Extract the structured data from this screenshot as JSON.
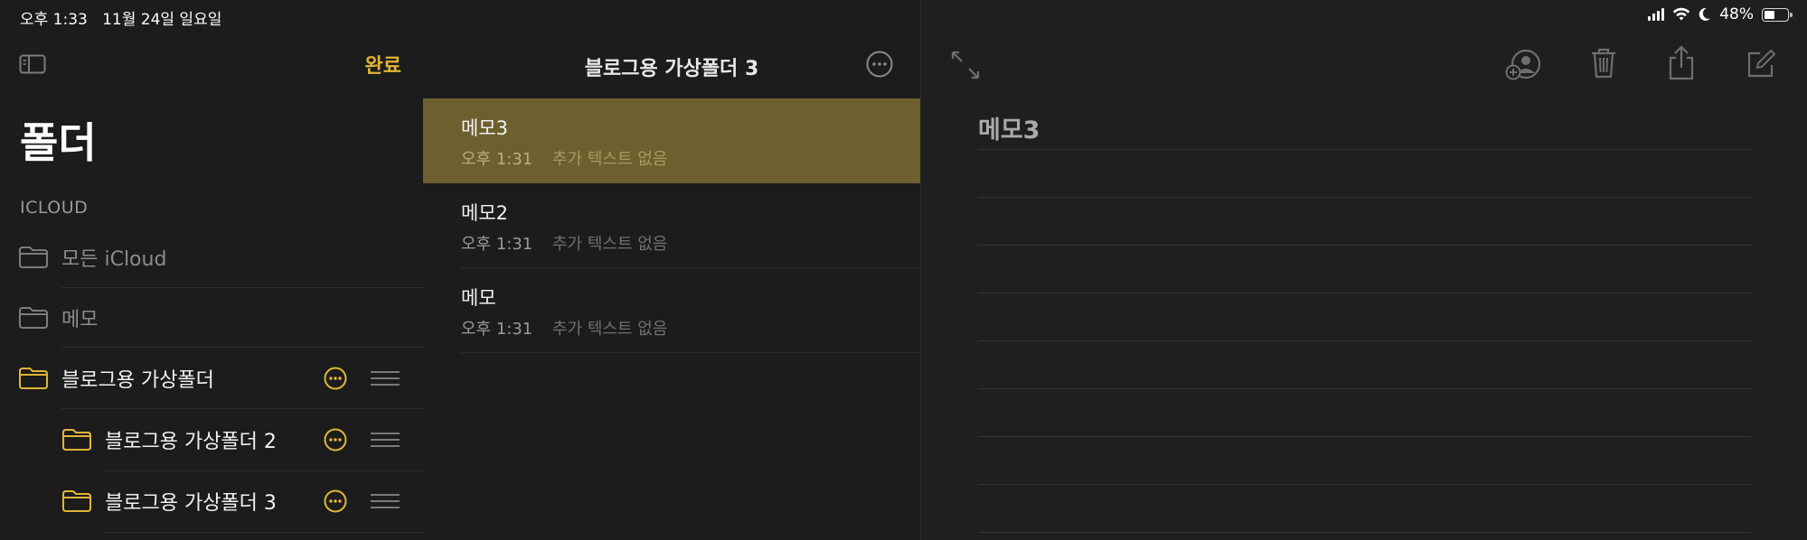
{
  "status": {
    "time": "오후 1:33",
    "date": "11월 24일 일요일",
    "battery": "48%",
    "battery_level": 0.48
  },
  "sidebar": {
    "done_label": "완료",
    "title": "폴더",
    "section": "ICLOUD",
    "folders": [
      {
        "label": "모든 iCloud"
      },
      {
        "label": "메모"
      },
      {
        "label": "블로그용 가상폴더"
      },
      {
        "label": "블로그용 가상폴더 2"
      },
      {
        "label": "블로그용 가상폴더 3"
      }
    ]
  },
  "list": {
    "title": "블로그용 가상폴더 3",
    "notes": [
      {
        "title": "메모3",
        "time": "오후 1:31",
        "snippet": "추가 텍스트 없음"
      },
      {
        "title": "메모2",
        "time": "오후 1:31",
        "snippet": "추가 텍스트 없음"
      },
      {
        "title": "메모",
        "time": "오후 1:31",
        "snippet": "추가 텍스트 없음"
      }
    ]
  },
  "detail": {
    "title": "메모3"
  },
  "colors": {
    "accent": "#e2b437",
    "selected_row": "#6e5f2f",
    "background": "#1c1c1d"
  }
}
